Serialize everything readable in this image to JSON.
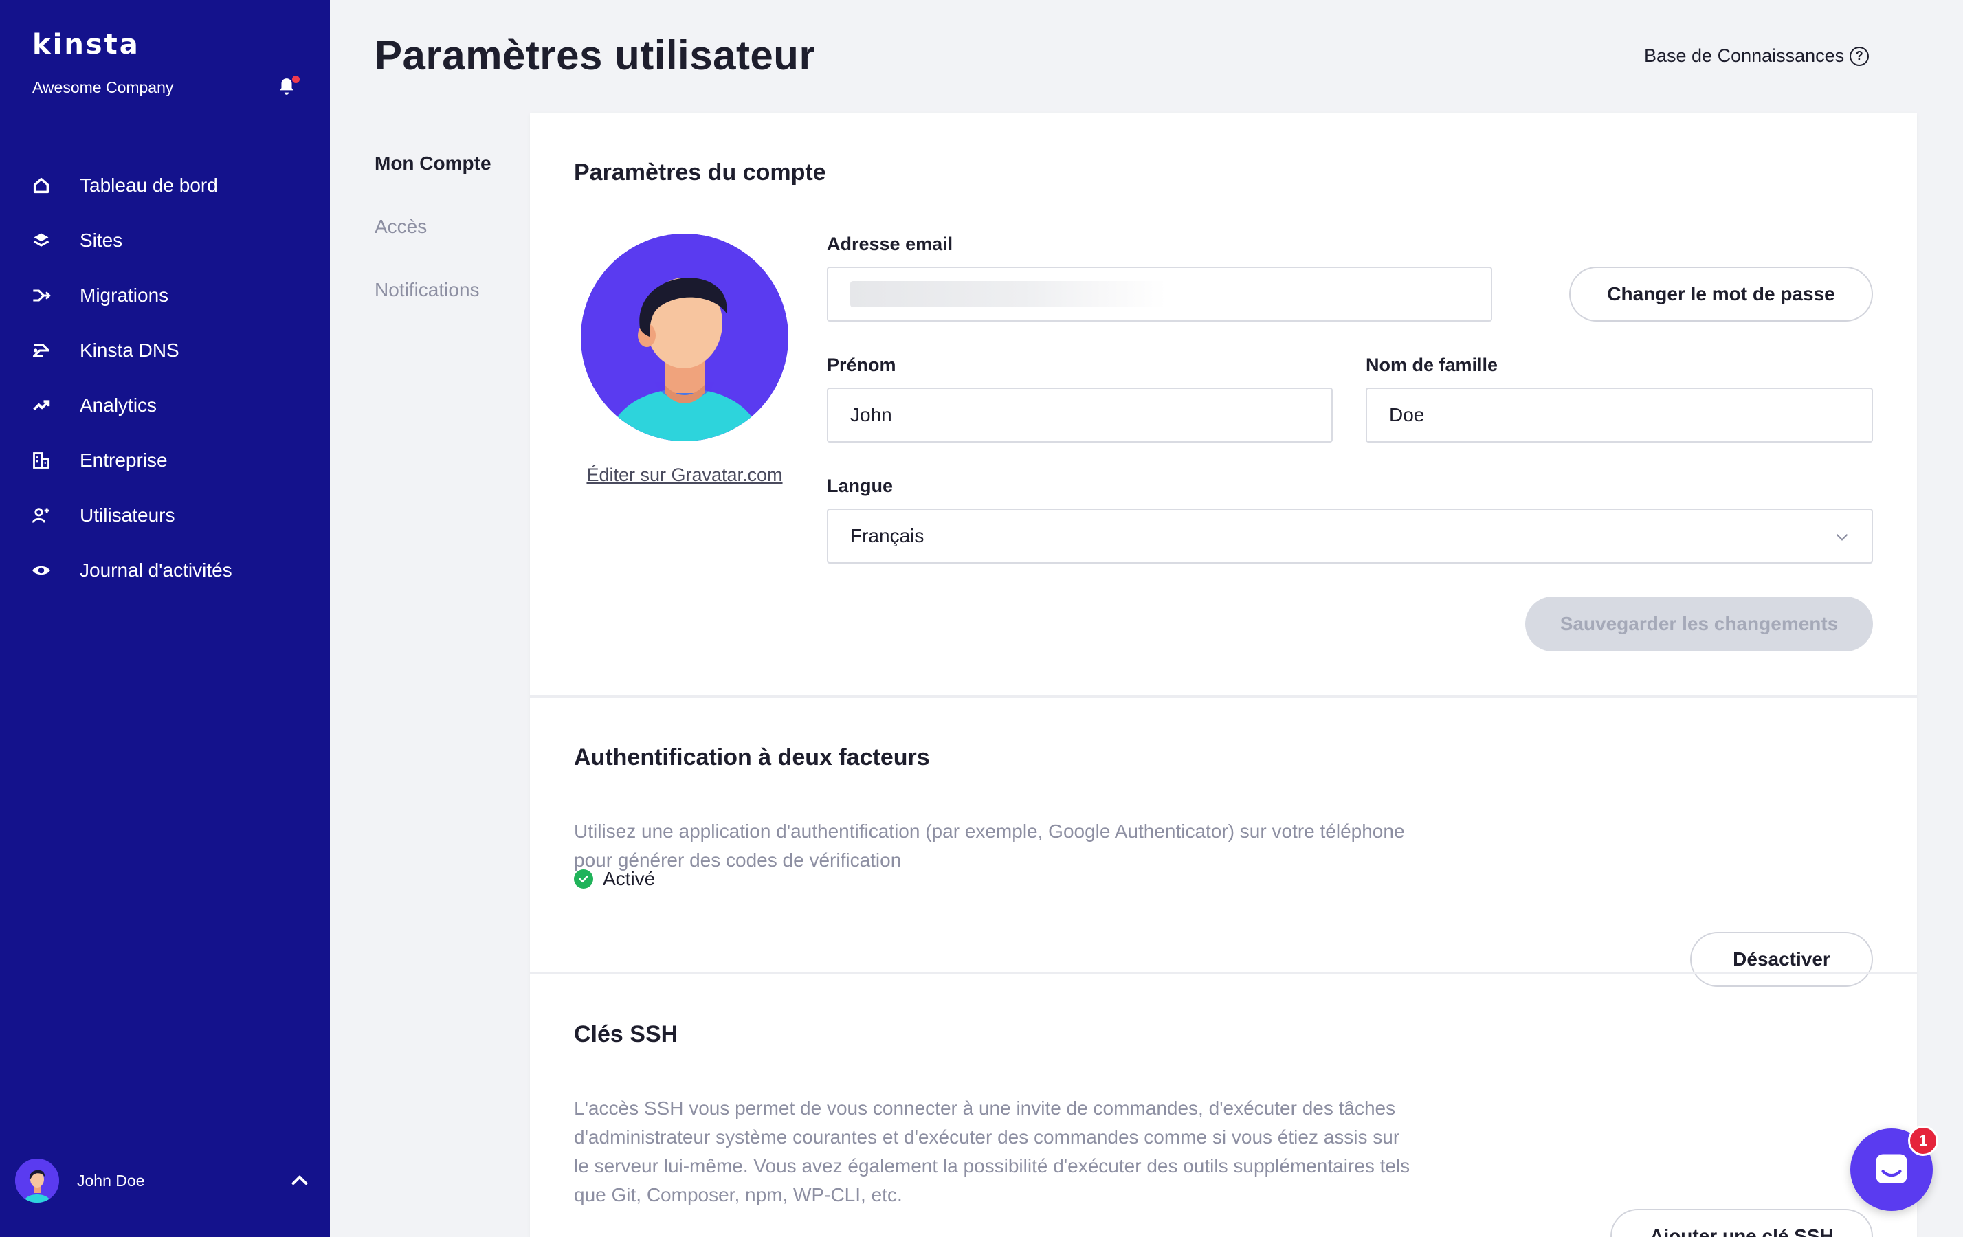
{
  "brand": {
    "logo": "kinsta",
    "company": "Awesome Company"
  },
  "sidebar": {
    "items": [
      {
        "label": "Tableau de bord",
        "icon": "home-icon"
      },
      {
        "label": "Sites",
        "icon": "layers-icon"
      },
      {
        "label": "Migrations",
        "icon": "migrations-icon"
      },
      {
        "label": "Kinsta DNS",
        "icon": "dns-icon"
      },
      {
        "label": "Analytics",
        "icon": "analytics-icon"
      },
      {
        "label": "Entreprise",
        "icon": "building-icon"
      },
      {
        "label": "Utilisateurs",
        "icon": "add-user-icon"
      },
      {
        "label": "Journal d'activités",
        "icon": "eye-icon"
      }
    ],
    "user": {
      "name": "John Doe"
    }
  },
  "header": {
    "title": "Paramètres utilisateur",
    "kb_link": "Base de Connaissances"
  },
  "subnav": {
    "items": [
      "Mon Compte",
      "Accès",
      "Notifications"
    ],
    "active": "Mon Compte"
  },
  "account": {
    "title": "Paramètres du compte",
    "gravatar_link": "Éditer sur Gravatar.com",
    "email_label": "Adresse email",
    "change_password": "Changer le mot de passe",
    "first_name_label": "Prénom",
    "first_name": "John",
    "last_name_label": "Nom de famille",
    "last_name": "Doe",
    "language_label": "Langue",
    "language": "Français",
    "save": "Sauvegarder les changements"
  },
  "twofa": {
    "title": "Authentification à deux facteurs",
    "description_line1": "Utilisez une application d'authentification (par exemple, Google Authenticator) sur votre téléphone",
    "description_line2": "pour générer des codes de vérification",
    "status": "Activé",
    "button": "Désactiver"
  },
  "ssh": {
    "title": "Clés SSH",
    "description_lines": [
      "L'accès SSH vous permet de vous connecter à une invite de commandes, d'exécuter des tâches",
      "d'administrateur système courantes et d'exécuter des commandes comme si vous étiez assis sur",
      "le serveur lui-même. Vous avez également la possibilité d'exécuter des outils supplémentaires tels",
      "que Git, Composer, npm, WP-CLI, etc."
    ],
    "button": "Ajouter une clé SSH"
  },
  "chat": {
    "badge": "1"
  },
  "colors": {
    "sidebar": "#14128c",
    "accent": "#5a3bf0",
    "success": "#20b35a",
    "badge": "#e5243b"
  }
}
